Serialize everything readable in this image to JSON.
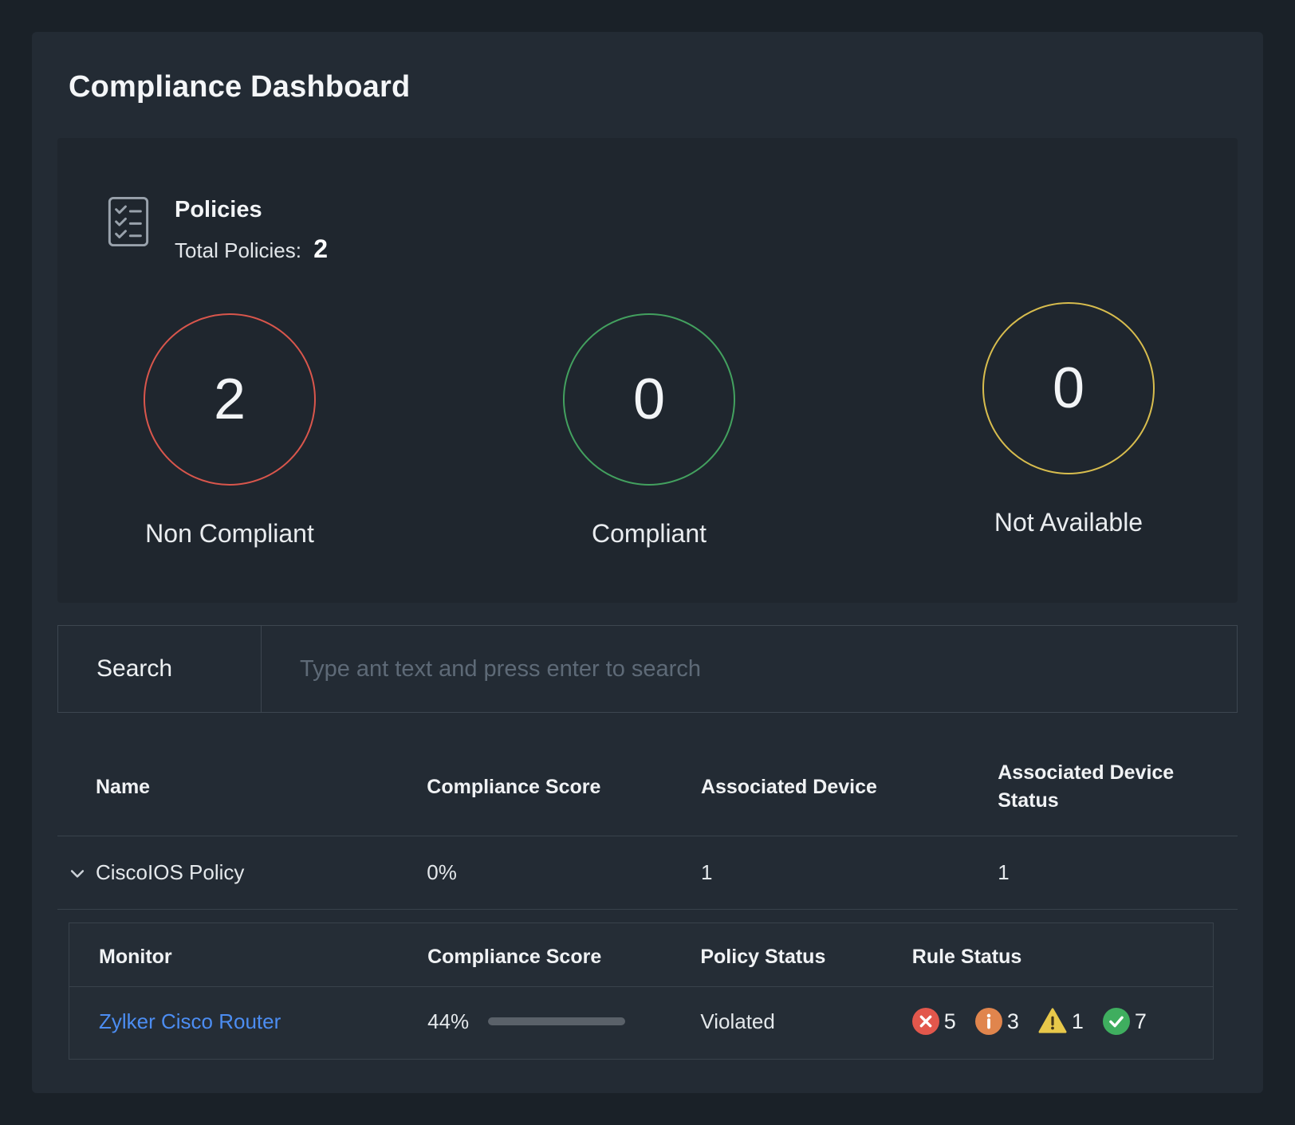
{
  "page": {
    "title": "Compliance Dashboard"
  },
  "policies": {
    "title": "Policies",
    "total_label": "Total Policies:",
    "total_value": "2",
    "stats": [
      {
        "value": "2",
        "label": "Non Compliant",
        "color": "#d9564c"
      },
      {
        "value": "0",
        "label": "Compliant",
        "color": "#43a15f"
      },
      {
        "value": "0",
        "label": "Not Available",
        "color": "#d8bd4e"
      }
    ]
  },
  "search": {
    "label": "Search",
    "placeholder": "Type ant text and press enter to search"
  },
  "policy_table": {
    "headers": [
      "Name",
      "Compliance Score",
      "Associated Device",
      "Associated Device Status"
    ],
    "row": {
      "name": "CiscoIOS Policy",
      "compliance_score": "0%",
      "associated_device": "1",
      "associated_device_status": "1"
    }
  },
  "monitor_table": {
    "headers": [
      "Monitor",
      "Compliance Score",
      "Policy Status",
      "Rule Status"
    ],
    "row": {
      "monitor": "Zylker Cisco Router",
      "compliance_score": "44%",
      "progress_percent": 44,
      "policy_status": "Violated",
      "rule_status": [
        {
          "icon": "error-icon",
          "count": "5",
          "color": "#e2574c"
        },
        {
          "icon": "info-icon",
          "count": "3",
          "color": "#e0854d"
        },
        {
          "icon": "warning-icon",
          "count": "1",
          "color": "#e8c84a"
        },
        {
          "icon": "success-icon",
          "count": "7",
          "color": "#3fae5f"
        }
      ]
    }
  },
  "colors": {
    "background": "#1a2128",
    "card": "#232b34",
    "panel": "#1f262e",
    "divider": "#39424b",
    "link": "#4c8df2",
    "progress_fill": "#4caf5e",
    "progress_track": "#5a6169"
  }
}
